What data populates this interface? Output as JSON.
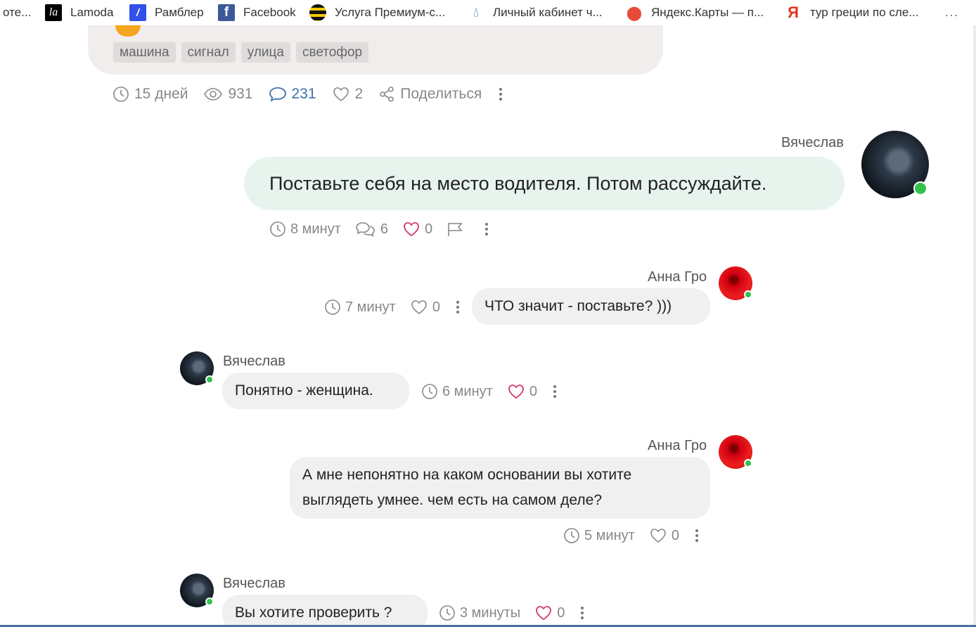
{
  "bookmarks": [
    {
      "label": "оте...",
      "icon": "none"
    },
    {
      "label": "Lamoda",
      "icon": "lamoda-icon"
    },
    {
      "label": "Рамблер",
      "icon": "rambler-icon"
    },
    {
      "label": "Facebook",
      "icon": "facebook-icon"
    },
    {
      "label": "Услуга Премиум-с...",
      "icon": "beeline-icon"
    },
    {
      "label": "Личный кабинет ч...",
      "icon": "gas-flame-icon"
    },
    {
      "label": "Яндекс.Карты — п...",
      "icon": "map-pin-icon"
    },
    {
      "label": "тур греции по сле...",
      "icon": "yandex-icon"
    }
  ],
  "bookmarks_more": "...",
  "post": {
    "tags": [
      "машина",
      "сигнал",
      "улица",
      "светофор"
    ],
    "stats": {
      "age": "15 дней",
      "views": "931",
      "comments": "231",
      "likes": "2",
      "share_label": "Поделиться"
    }
  },
  "comments": [
    {
      "author": "Вячеслав",
      "text": "Поставьте себя на место водителя. Потом рассуждайте.",
      "time": "8 минут",
      "replies": "6",
      "likes": "0"
    },
    {
      "author": "Анна Гро",
      "text": "ЧТО значит - поставьте? )))",
      "time": "7 минут",
      "likes": "0"
    },
    {
      "author": "Вячеслав",
      "text": "Понятно - женщина.",
      "time": "6 минут",
      "likes": "0"
    },
    {
      "author": "Анна Гро",
      "text_line1": "А мне непонятно на каком основании вы хотите",
      "text_line2": "выглядеть умнее. чем есть на самом деле?",
      "time": "5 минут",
      "likes": "0"
    },
    {
      "author": "Вячеслав",
      "text": "Вы хотите проверить ?",
      "time": "3 минуты",
      "likes": "0"
    }
  ],
  "colors": {
    "accent_blue": "#3f6fb0",
    "like_pink": "#d1386d",
    "online_green": "#33c24d",
    "main_bubble": "#e7f4ee",
    "reply_bubble": "#f0f0f0"
  }
}
